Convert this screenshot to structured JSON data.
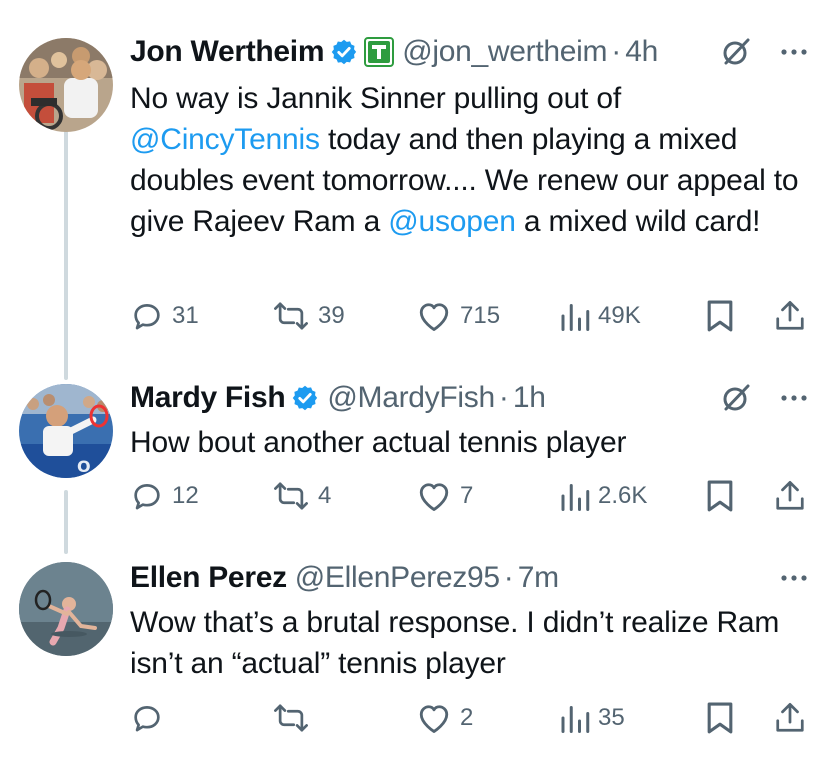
{
  "tweets": [
    {
      "name": "Jon Wertheim",
      "handle": "@jon_wertheim",
      "separator": "·",
      "time": "4h",
      "verified": true,
      "affiliation_badge": "tennis-channel-badge",
      "text_parts": [
        "No way is Jannik Sinner pulling out of",
        "@CincyTennis",
        "today and then playing a mixed doubles event tomorrow.... We renew our appeal to give Rajeev Ram a",
        "@usopen",
        "a mixed wild card!"
      ],
      "replies": "31",
      "reposts": "39",
      "likes": "715",
      "views": "49K",
      "grok_icon": "grok-icon",
      "more_icon": "more-icon"
    },
    {
      "name": "Mardy Fish",
      "handle": "@MardyFish",
      "separator": "·",
      "time": "1h",
      "verified": true,
      "text": "How bout another actual tennis player",
      "replies": "12",
      "reposts": "4",
      "likes": "7",
      "views": "2.6K",
      "grok_icon": "grok-icon",
      "more_icon": "more-icon"
    },
    {
      "name": "Ellen Perez",
      "handle": "@EllenPerez95",
      "separator": "·",
      "time": "7m",
      "verified": false,
      "text": "Wow that’s a brutal response. I didn’t realize Ram isn’t an “actual” tennis player",
      "replies": "",
      "reposts": "",
      "likes": "2",
      "views": "35",
      "more_icon": "more-icon"
    }
  ],
  "colors": {
    "link": "#1d9bf0",
    "muted": "#536471",
    "verified": "#1d9bf0",
    "thread_line": "#cfd9de"
  }
}
